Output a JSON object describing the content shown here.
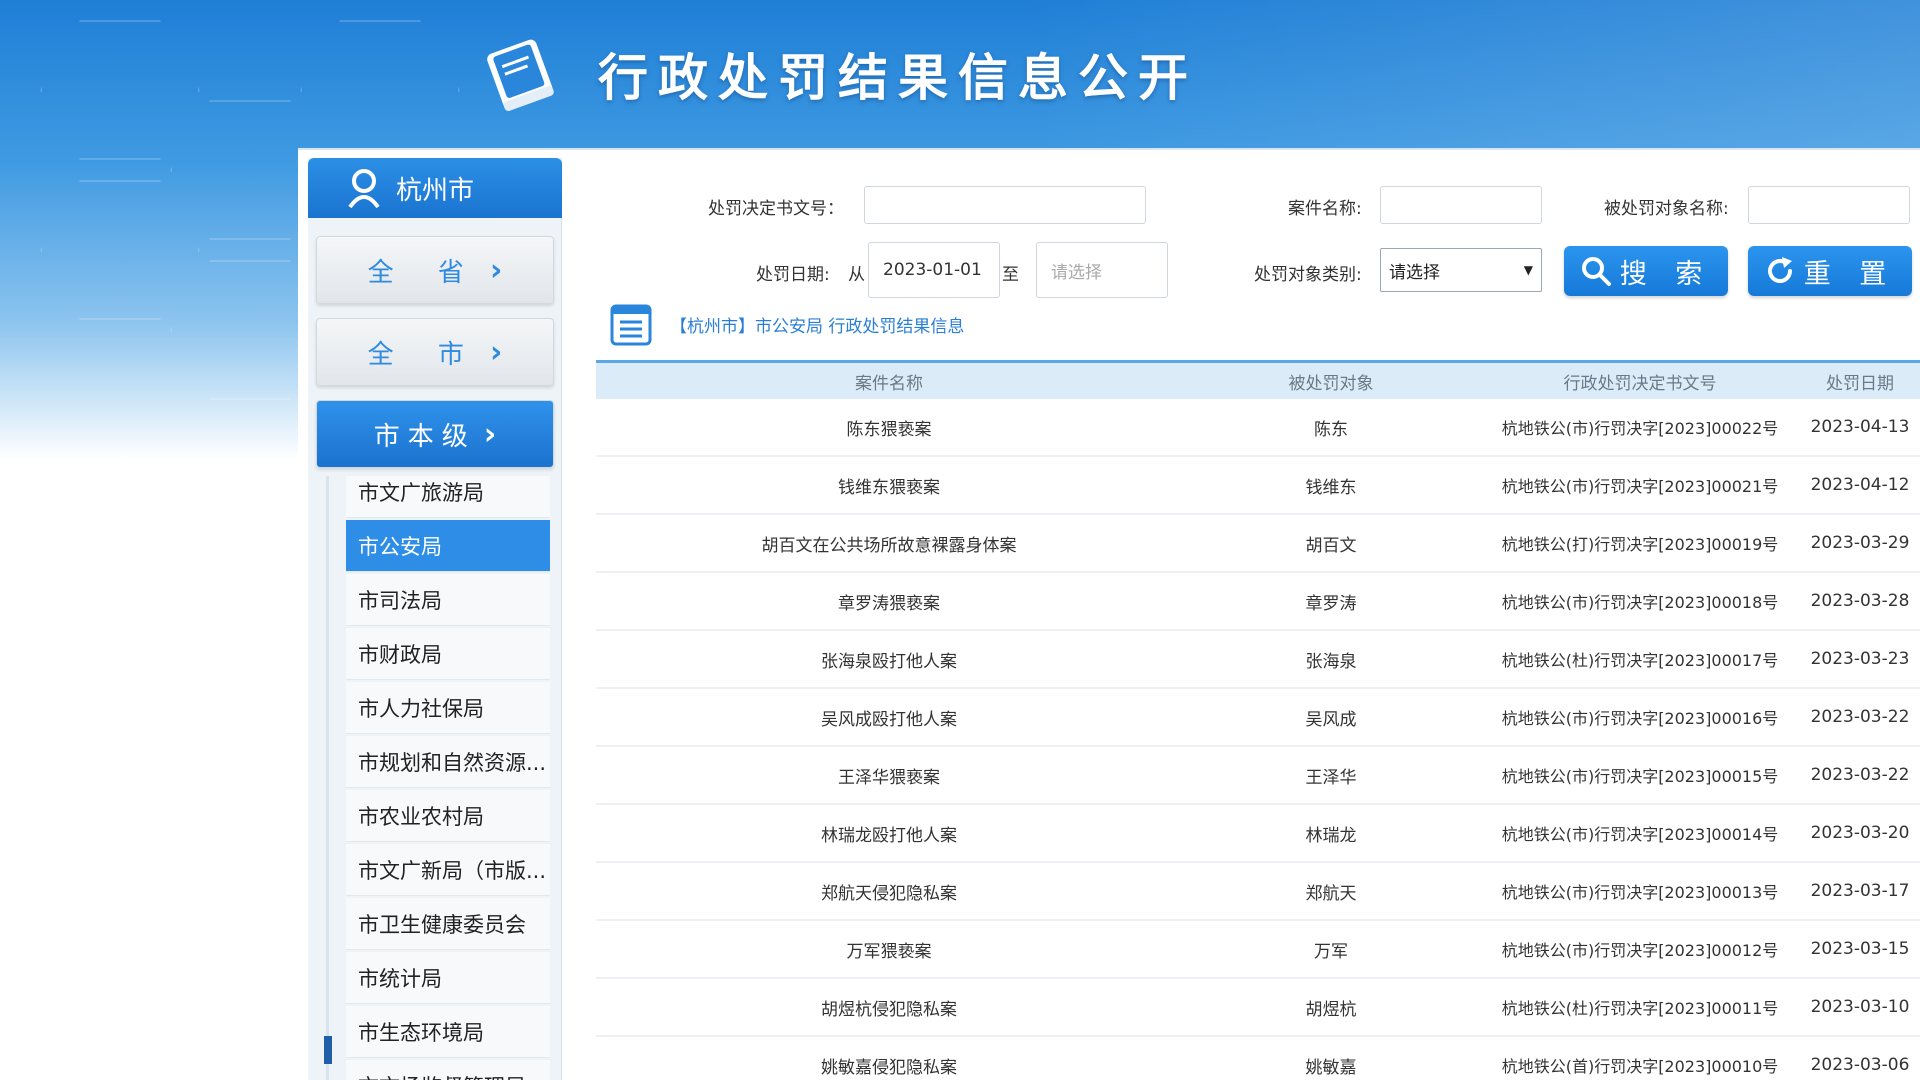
{
  "header": {
    "title": "行政处罚结果信息公开"
  },
  "sidebar": {
    "city": "杭州市",
    "levels": [
      {
        "label": "全 省",
        "active": false
      },
      {
        "label": "全 市",
        "active": false
      },
      {
        "label": "市本级",
        "active": true
      }
    ],
    "departments": [
      "市文广旅游局",
      "市公安局",
      "市司法局",
      "市财政局",
      "市人力社保局",
      "市规划和自然资源...",
      "市农业农村局",
      "市文广新局（市版...",
      "市卫生健康委员会",
      "市统计局",
      "市生态环境局",
      "市市场监督管理局"
    ],
    "selected_department": "市公安局"
  },
  "search": {
    "doc_no_label": "处罚决定书文号：",
    "doc_no_value": "",
    "case_name_label": "案件名称:",
    "case_name_value": "",
    "target_name_label": "被处罚对象名称:",
    "target_name_value": "",
    "date_label": "处罚日期:",
    "from_label": "从",
    "date_from": "2023-01-01",
    "to_label": "至",
    "date_to_placeholder": "请选择",
    "category_label": "处罚对象类别:",
    "category_value": "请选择",
    "search_button": "搜 索",
    "reset_button": "重 置"
  },
  "breadcrumb": "【杭州市】市公安局 行政处罚结果信息",
  "table": {
    "headers": [
      "案件名称",
      "被处罚对象",
      "行政处罚决定书文号",
      "处罚日期"
    ],
    "rows": [
      [
        "陈东猥亵案",
        "陈东",
        "杭地铁公(市)行罚决字[2023]00022号",
        "2023-04-13"
      ],
      [
        "钱维东猥亵案",
        "钱维东",
        "杭地铁公(市)行罚决字[2023]00021号",
        "2023-04-12"
      ],
      [
        "胡百文在公共场所故意裸露身体案",
        "胡百文",
        "杭地铁公(打)行罚决字[2023]00019号",
        "2023-03-29"
      ],
      [
        "章罗涛猥亵案",
        "章罗涛",
        "杭地铁公(市)行罚决字[2023]00018号",
        "2023-03-28"
      ],
      [
        "张海泉殴打他人案",
        "张海泉",
        "杭地铁公(杜)行罚决字[2023]00017号",
        "2023-03-23"
      ],
      [
        "吴风成殴打他人案",
        "吴风成",
        "杭地铁公(市)行罚决字[2023]00016号",
        "2023-03-22"
      ],
      [
        "王泽华猥亵案",
        "王泽华",
        "杭地铁公(市)行罚决字[2023]00015号",
        "2023-03-22"
      ],
      [
        "林瑞龙殴打他人案",
        "林瑞龙",
        "杭地铁公(市)行罚决字[2023]00014号",
        "2023-03-20"
      ],
      [
        "郑航天侵犯隐私案",
        "郑航天",
        "杭地铁公(市)行罚决字[2023]00013号",
        "2023-03-17"
      ],
      [
        "万军猥亵案",
        "万军",
        "杭地铁公(市)行罚决字[2023]00012号",
        "2023-03-15"
      ],
      [
        "胡煜杭侵犯隐私案",
        "胡煜杭",
        "杭地铁公(杜)行罚决字[2023]00011号",
        "2023-03-10"
      ],
      [
        "姚敏嘉侵犯隐私案",
        "姚敏嘉",
        "杭地铁公(首)行罚决字[2023]00010号",
        "2023-03-06"
      ]
    ]
  },
  "colors": {
    "primary": "#1f7fd6",
    "accent": "#2e8de6",
    "header_row": "#dcebf8"
  },
  "icons": [
    "book-icon",
    "location-pin-icon",
    "chevron-right-icon",
    "search-icon",
    "refresh-icon",
    "list-icon",
    "dropdown-arrow-icon"
  ]
}
